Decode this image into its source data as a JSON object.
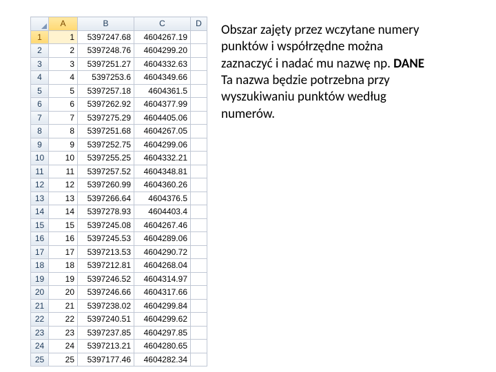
{
  "columns": [
    "A",
    "B",
    "C",
    "D"
  ],
  "rows": [
    {
      "n": 1,
      "a": "1",
      "b": "5397247.68",
      "c": "4604267.19"
    },
    {
      "n": 2,
      "a": "2",
      "b": "5397248.76",
      "c": "4604299.20"
    },
    {
      "n": 3,
      "a": "3",
      "b": "5397251.27",
      "c": "4604332.63"
    },
    {
      "n": 4,
      "a": "4",
      "b": "5397253.6",
      "c": "4604349.66"
    },
    {
      "n": 5,
      "a": "5",
      "b": "5397257.18",
      "c": "4604361.5"
    },
    {
      "n": 6,
      "a": "6",
      "b": "5397262.92",
      "c": "4604377.99"
    },
    {
      "n": 7,
      "a": "7",
      "b": "5397275.29",
      "c": "4604405.06"
    },
    {
      "n": 8,
      "a": "8",
      "b": "5397251.68",
      "c": "4604267.05"
    },
    {
      "n": 9,
      "a": "9",
      "b": "5397252.75",
      "c": "4604299.06"
    },
    {
      "n": 10,
      "a": "10",
      "b": "5397255.25",
      "c": "4604332.21"
    },
    {
      "n": 11,
      "a": "11",
      "b": "5397257.52",
      "c": "4604348.81"
    },
    {
      "n": 12,
      "a": "12",
      "b": "5397260.99",
      "c": "4604360.26"
    },
    {
      "n": 13,
      "a": "13",
      "b": "5397266.64",
      "c": "4604376.5"
    },
    {
      "n": 14,
      "a": "14",
      "b": "5397278.93",
      "c": "4604403.4"
    },
    {
      "n": 15,
      "a": "15",
      "b": "5397245.08",
      "c": "4604267.46"
    },
    {
      "n": 16,
      "a": "16",
      "b": "5397245.53",
      "c": "4604289.06"
    },
    {
      "n": 17,
      "a": "17",
      "b": "5397213.53",
      "c": "4604290.72"
    },
    {
      "n": 18,
      "a": "18",
      "b": "5397212.81",
      "c": "4604268.04"
    },
    {
      "n": 19,
      "a": "19",
      "b": "5397246.52",
      "c": "4604314.97"
    },
    {
      "n": 20,
      "a": "20",
      "b": "5397246.66",
      "c": "4604317.66"
    },
    {
      "n": 21,
      "a": "21",
      "b": "5397238.02",
      "c": "4604299.84"
    },
    {
      "n": 22,
      "a": "22",
      "b": "5397240.51",
      "c": "4604299.62"
    },
    {
      "n": 23,
      "a": "23",
      "b": "5397237.85",
      "c": "4604297.85"
    },
    {
      "n": 24,
      "a": "24",
      "b": "5397213.21",
      "c": "4604280.65"
    },
    {
      "n": 25,
      "a": "25",
      "b": "5397177.46",
      "c": "4604282.34"
    }
  ],
  "note": {
    "p1a": "Obszar zajęty przez wczytane numery punktów i współrzędne można zaznaczyć i nadać mu nazwę np. ",
    "p1b": "DANE",
    "p2": "Ta nazwa będzie potrzebna przy wyszukiwaniu punktów według numerów."
  }
}
